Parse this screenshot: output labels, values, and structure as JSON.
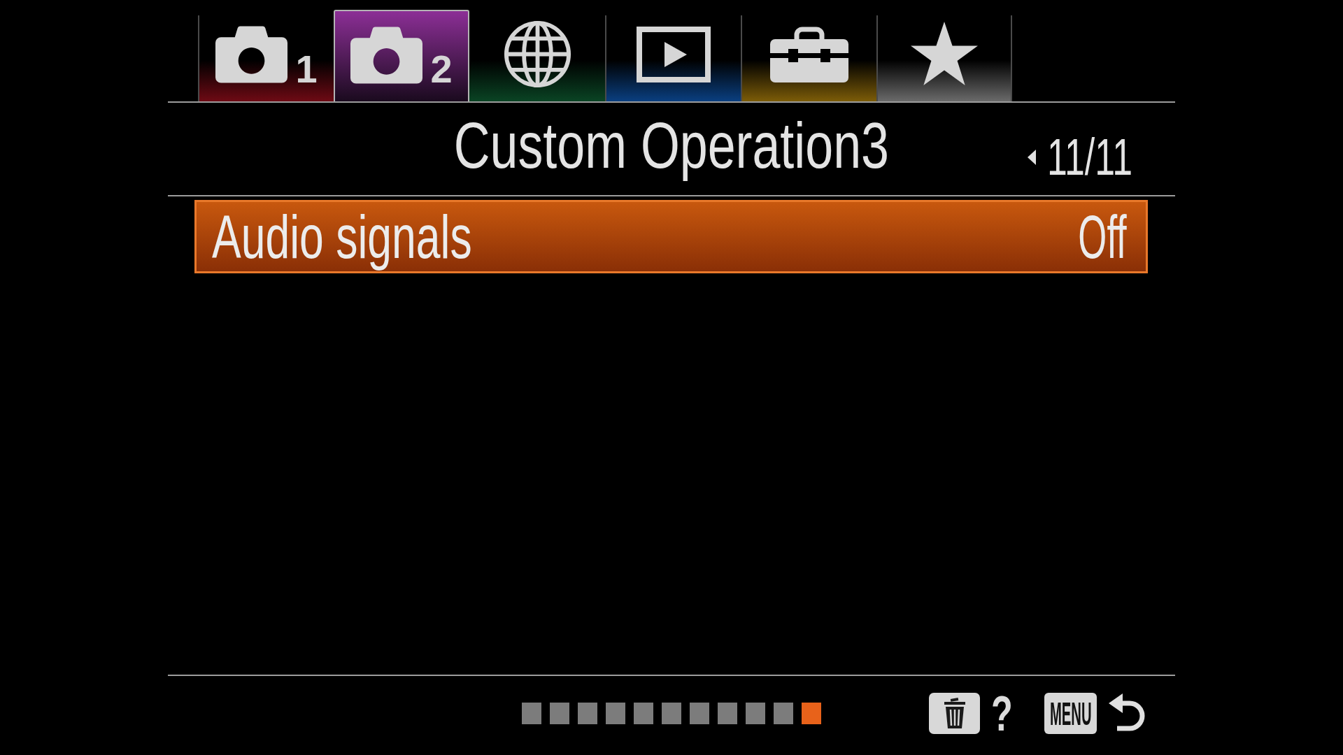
{
  "tabs": [
    {
      "kind": "camera",
      "number": "1",
      "color": "#6e0a14",
      "selected": false
    },
    {
      "kind": "camera",
      "number": "2",
      "color": "#8c2f96",
      "selected": true
    },
    {
      "kind": "globe",
      "color": "#0a4424",
      "selected": false
    },
    {
      "kind": "playback",
      "color": "#0a3f80",
      "selected": false
    },
    {
      "kind": "toolbox",
      "color": "#7c5c08",
      "selected": false
    },
    {
      "kind": "star",
      "color": "#6a6a6a",
      "selected": false
    }
  ],
  "header": {
    "title": "Custom Operation3",
    "page": "11/11"
  },
  "items": [
    {
      "label": "Audio signals",
      "value": "Off",
      "selected": true
    }
  ],
  "page_dots": [
    {
      "selected": false
    },
    {
      "selected": false
    },
    {
      "selected": false
    },
    {
      "selected": false
    },
    {
      "selected": false
    },
    {
      "selected": false
    },
    {
      "selected": false
    },
    {
      "selected": false
    },
    {
      "selected": false
    },
    {
      "selected": false
    },
    {
      "selected": true
    }
  ],
  "key_guide": {
    "help": "?",
    "menu_key": "MENU"
  }
}
